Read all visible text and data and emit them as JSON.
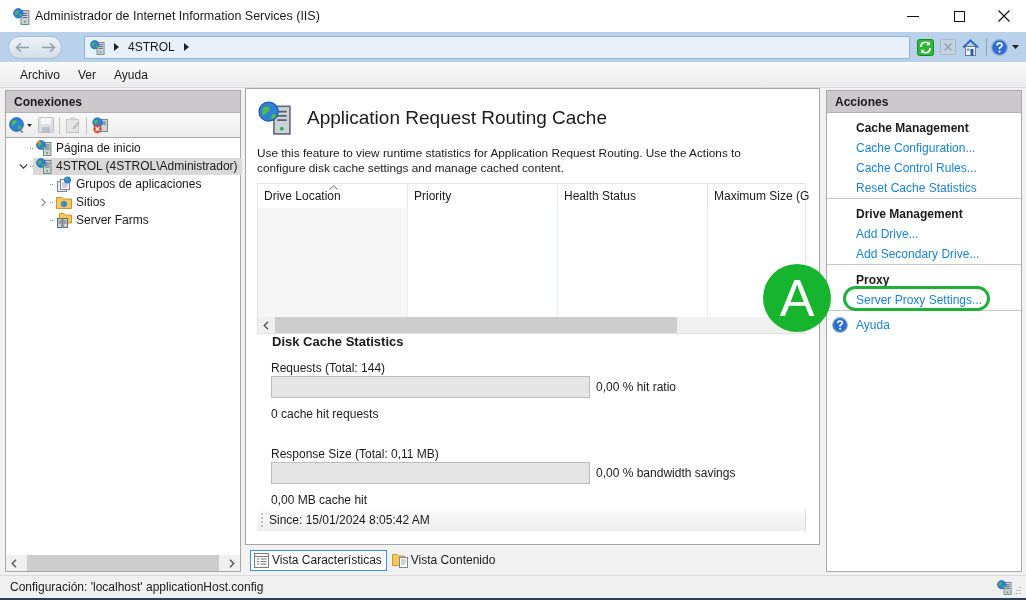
{
  "window": {
    "title": "Administrador de Internet Information Services (IIS)"
  },
  "address_bar": {
    "nav": [
      {
        "kind": "back",
        "disabled": true
      },
      {
        "kind": "forward",
        "disabled": true
      }
    ],
    "path": [
      "4STROL"
    ],
    "tools": [
      {
        "kind": "refresh",
        "disabled": false
      },
      {
        "kind": "stop",
        "disabled": true
      },
      {
        "kind": "home",
        "disabled": false
      },
      {
        "kind": "help",
        "disabled": false
      }
    ]
  },
  "menu": [
    "Archivo",
    "Ver",
    "Ayuda"
  ],
  "connections": {
    "title": "Conexiones",
    "toolbar": [
      {
        "kind": "connect",
        "disabled": false
      },
      {
        "kind": "save",
        "disabled": true
      },
      {
        "kind": "separator"
      },
      {
        "kind": "add",
        "disabled": true
      },
      {
        "kind": "separator"
      },
      {
        "kind": "disconnect",
        "disabled": false
      }
    ],
    "tree": [
      {
        "label": "Página de inicio",
        "kind": "start",
        "selected": false
      },
      {
        "label": "4STROL (4STROL\\Administrador)",
        "kind": "server",
        "selected": true,
        "expanded": true,
        "children": [
          {
            "label": "Grupos de aplicaciones",
            "kind": "pools",
            "selected": false
          },
          {
            "label": "Sitios",
            "kind": "sites",
            "selected": false,
            "expanded": false
          },
          {
            "label": "Server Farms",
            "kind": "farms",
            "selected": false
          }
        ]
      }
    ]
  },
  "feature": {
    "title": "Application Request Routing Cache",
    "description": "Use this feature to view runtime statistics for Application Request Routing. Use the Actions to configure disk cache settings and manage cached content.",
    "table": {
      "columns": [
        {
          "label": "Drive Location",
          "sorted": true
        },
        {
          "label": "Priority",
          "sorted": false
        },
        {
          "label": "Health Status",
          "sorted": false
        },
        {
          "label": "Maximum Size (G",
          "sorted": false
        }
      ]
    },
    "section_title": "Disk Cache Statistics",
    "stats": [
      {
        "label": "Requests (Total: 144)",
        "level": 0,
        "reading": "0,00 % hit ratio",
        "detail": "0 cache hit requests"
      },
      {
        "label": "Response Size (Total: 0,11 MB)",
        "level": 0,
        "reading": "0,00 % bandwidth savings",
        "detail": "0,00 MB cache hit"
      }
    ],
    "since": "Since: 15/01/2024 8:05:42 AM"
  },
  "view_tabs": [
    {
      "label": "Vista Características",
      "kind": "features",
      "selected": true
    },
    {
      "label": "Vista Contenido",
      "kind": "content",
      "selected": false
    }
  ],
  "actions": {
    "title": "Acciones",
    "groups": [
      {
        "title": "Cache Management",
        "items": [
          {
            "label": "Cache Configuration...",
            "highlighted": false
          },
          {
            "label": "Cache Control Rules...",
            "highlighted": false
          },
          {
            "label": "Reset Cache Statistics",
            "highlighted": false
          }
        ]
      },
      {
        "title": "Drive Management",
        "items": [
          {
            "label": "Add Drive...",
            "highlighted": false
          },
          {
            "label": "Add Secondary Drive...",
            "highlighted": false
          }
        ]
      },
      {
        "title": "Proxy",
        "items": [
          {
            "label": "Server Proxy Settings...",
            "highlighted": true
          }
        ]
      }
    ],
    "help": "Ayuda"
  },
  "annotation": {
    "label": "A"
  },
  "status_bar": {
    "text": "Configuración: 'localhost' applicationHost.config"
  }
}
